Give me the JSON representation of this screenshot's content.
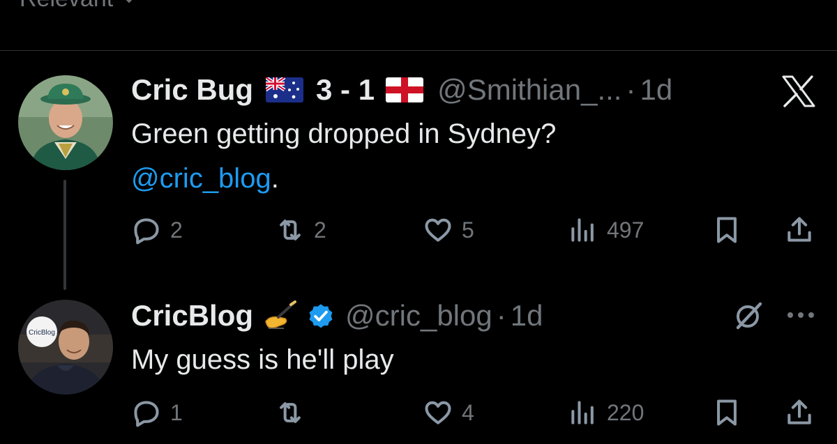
{
  "header": {
    "sort_label": "Relevant"
  },
  "tweets": [
    {
      "display_name": "Cric Bug",
      "score": "3 - 1",
      "handle": "@Smithian_...",
      "dot": "·",
      "time": "1d",
      "body_line1": "Green getting dropped in Sydney?",
      "mention": "@cric_blog",
      "mention_suffix": ".",
      "stats": {
        "replies": "2",
        "reposts": "2",
        "likes": "5",
        "views": "497"
      }
    },
    {
      "display_name": "CricBlog",
      "handle": "@cric_blog",
      "dot": "·",
      "time": "1d",
      "body_line1": "My guess is he'll play",
      "avatar_logo_text": "CricBlog",
      "stats": {
        "replies": "1",
        "reposts": "",
        "likes": "4",
        "views": "220"
      }
    }
  ],
  "colors": {
    "accent": "#1d9bf0",
    "muted": "#71767b",
    "text": "#e7e9ea",
    "background": "#000000"
  },
  "icons": [
    "chevron-down-icon",
    "australia-flag-icon",
    "england-flag-icon",
    "x-logo-icon",
    "verified-badge-icon",
    "writing-hand-emoji-icon",
    "grok-icon",
    "more-icon",
    "reply-icon",
    "repost-icon",
    "like-icon",
    "views-icon",
    "bookmark-icon",
    "share-icon"
  ]
}
